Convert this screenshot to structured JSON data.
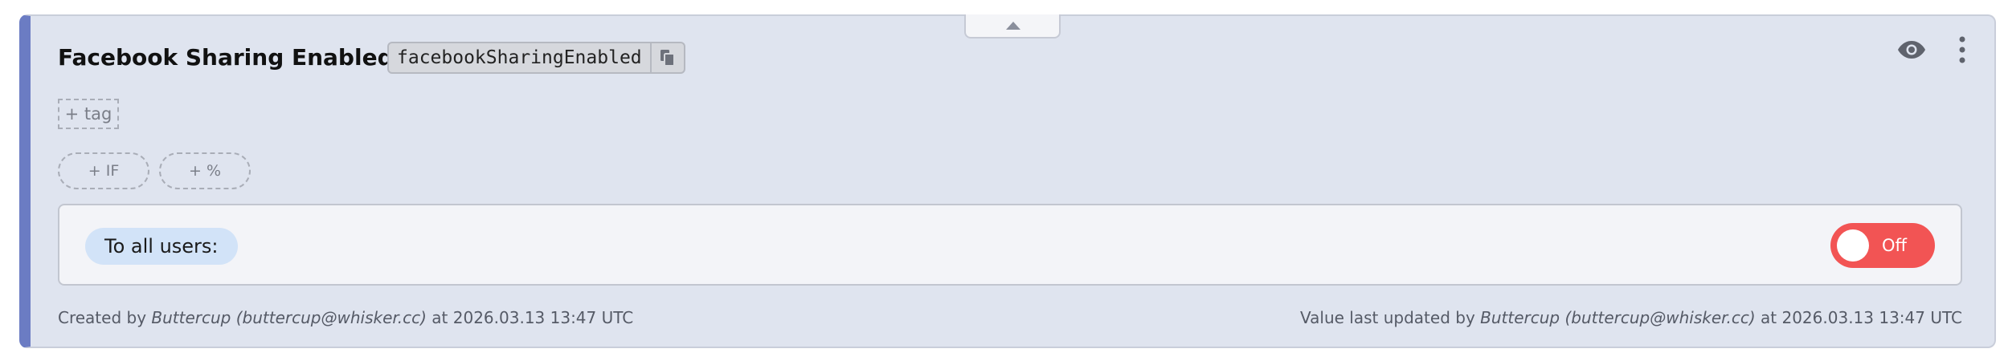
{
  "feature": {
    "title": "Facebook Sharing Enabled",
    "key": "facebookSharingEnabled"
  },
  "tags": {
    "add_label": "+ tag"
  },
  "conditions": {
    "add_if_label": "+ IF",
    "add_percent_label": "+ %"
  },
  "rule": {
    "audience_label": "To all users:",
    "toggle_label": "Off",
    "toggle_state": "off"
  },
  "footer": {
    "created_prefix": "Created by ",
    "created_by": "Buttercup (buttercup@whisker.cc)",
    "created_at": " at 2026.03.13 13:47 UTC",
    "updated_prefix": "Value last updated by ",
    "updated_by": "Buttercup (buttercup@whisker.cc)",
    "updated_at": " at 2026.03.13 13:47 UTC"
  },
  "icons": {
    "collapse": "chevron-up-icon",
    "copy": "copy-icon",
    "visibility": "eye-icon",
    "menu": "more-vertical-icon"
  },
  "colors": {
    "accent_bar": "#6b7cc3",
    "card_background": "#dfe4ef",
    "toggle_off": "#f25454",
    "audience_pill": "#d2e3f8"
  }
}
